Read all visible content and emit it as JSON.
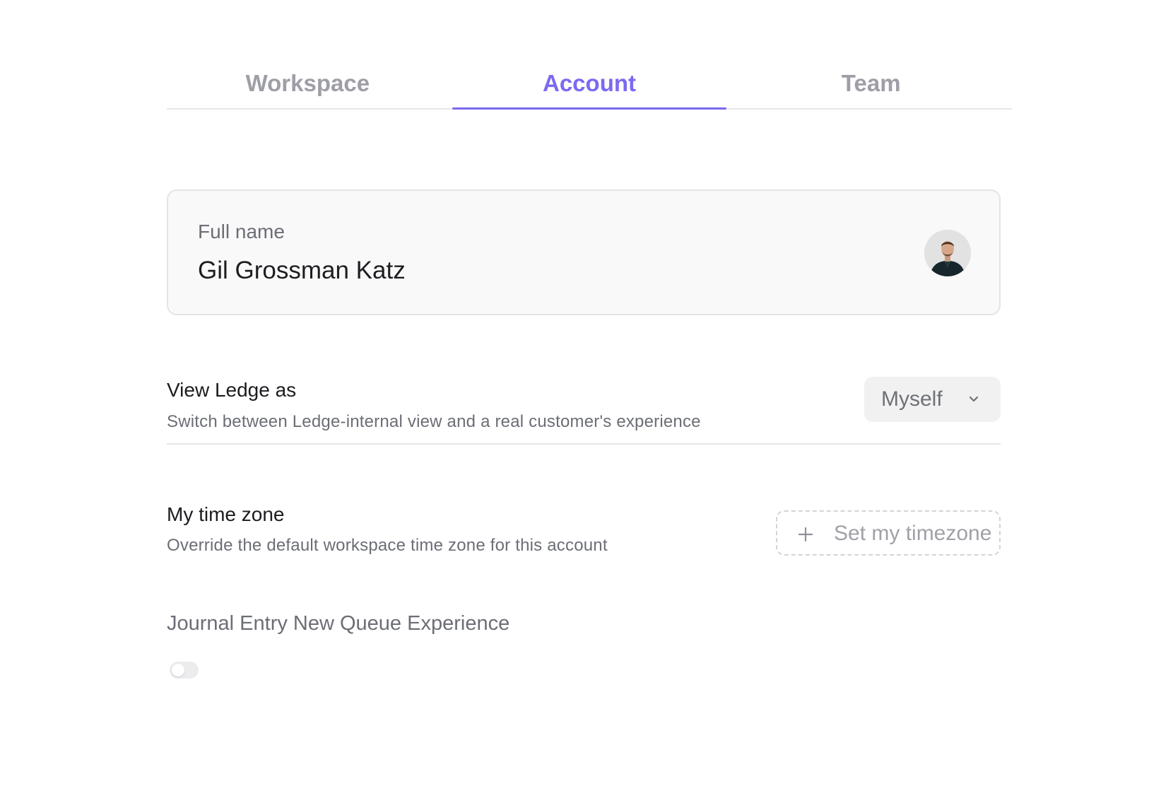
{
  "tabs": [
    {
      "label": "Workspace",
      "active": false
    },
    {
      "label": "Account",
      "active": true
    },
    {
      "label": "Team",
      "active": false
    }
  ],
  "profile": {
    "full_name_label": "Full name",
    "full_name_value": "Gil Grossman Katz",
    "avatar_icon": "user-avatar-photo"
  },
  "view_as": {
    "title": "View Ledge as",
    "description": "Switch between Ledge-internal view and a real customer's experience",
    "selected": "Myself",
    "icon": "chevron-down-icon"
  },
  "timezone": {
    "title": "My time zone",
    "description": "Override the default workspace time zone for this account",
    "button_label": "Set my timezone",
    "icon": "plus-icon"
  },
  "journal": {
    "title": "Journal Entry New Queue Experience",
    "toggle_on": false
  },
  "colors": {
    "accent": "#7b6af0",
    "muted_text": "#6c6e76",
    "tab_inactive": "#9e9fa6"
  }
}
